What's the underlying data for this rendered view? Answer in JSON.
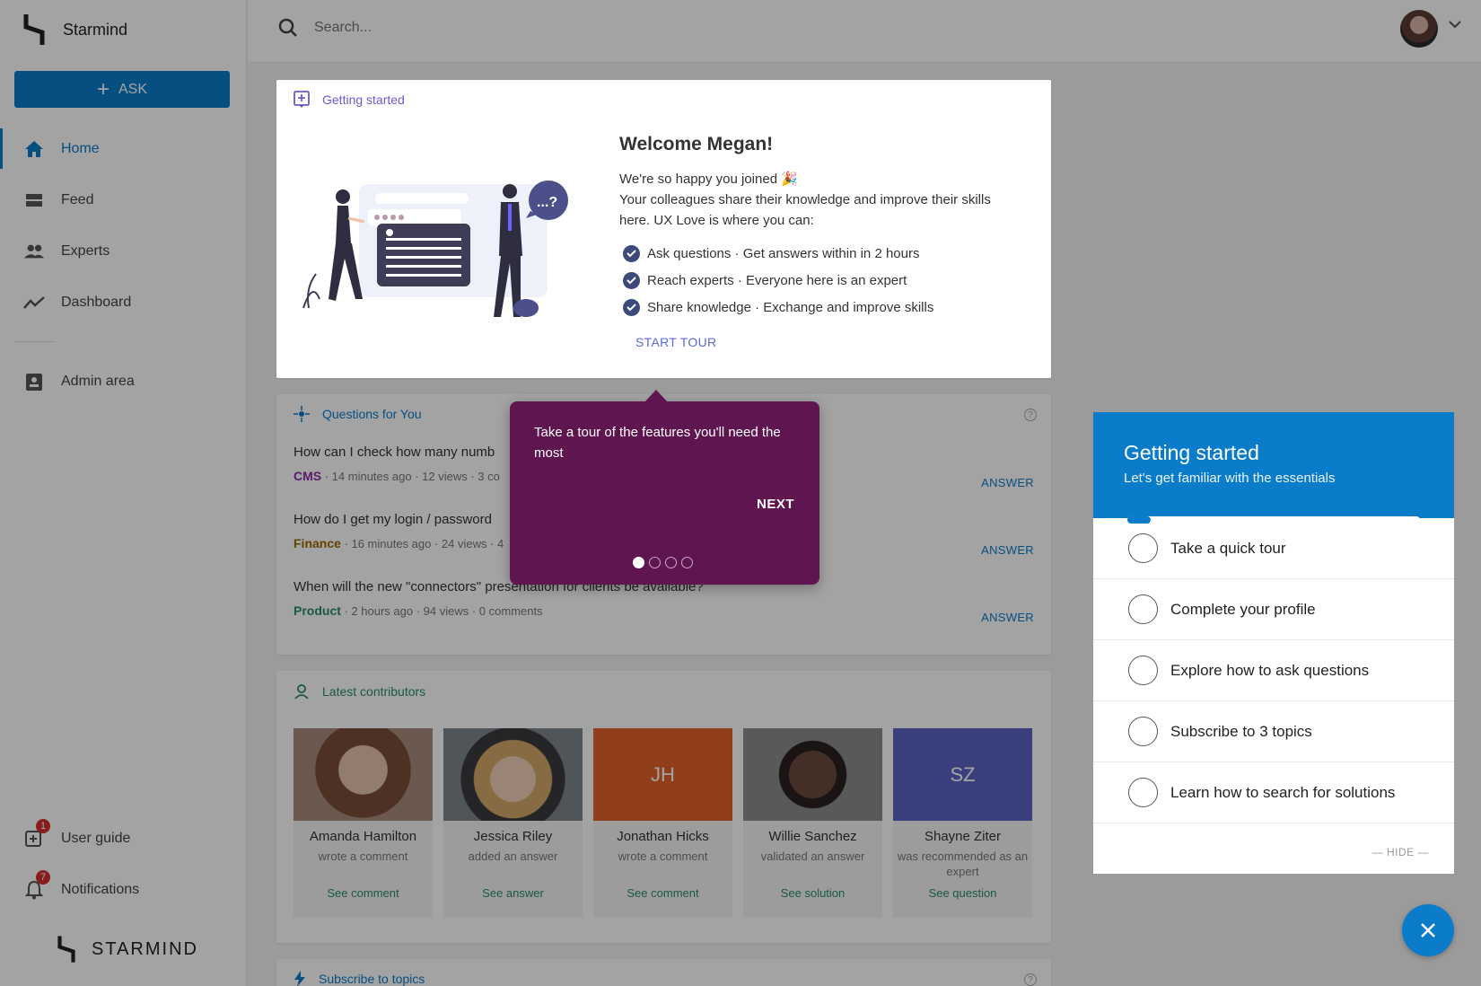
{
  "app": {
    "brand_name": "Starmind",
    "footer_brand": "STARMIND"
  },
  "sidebar": {
    "ask_label": "ASK",
    "items": [
      {
        "label": "Home",
        "icon": "home-icon",
        "active": true
      },
      {
        "label": "Feed",
        "icon": "feed-icon"
      },
      {
        "label": "Experts",
        "icon": "experts-icon"
      },
      {
        "label": "Dashboard",
        "icon": "dashboard-icon"
      }
    ],
    "admin_label": "Admin area",
    "user_guide_label": "User guide",
    "user_guide_badge": "1",
    "notifications_label": "Notifications",
    "notifications_badge": "7"
  },
  "search": {
    "placeholder": "Search..."
  },
  "welcome_card": {
    "header": "Getting started",
    "title": "Welcome Megan!",
    "text_line1": "We're so happy you joined 🎉",
    "text_line2": "Your colleagues share their knowledge and improve their skills here. UX Love is where you can:",
    "checks": [
      "Ask questions · Get answers within in 2 hours",
      "Reach experts · Everyone here is an expert",
      "Share knowledge · Exchange and improve skills"
    ],
    "start_tour": "START TOUR",
    "bubble_text": "...?"
  },
  "questions": {
    "header": "Questions for You",
    "help": "?",
    "answer_label": "ANSWER",
    "items": [
      {
        "title": "How can I check how many numb",
        "category": "CMS",
        "category_color": "#8a2da8",
        "meta": " · 14 minutes ago · 12 views · 3 co"
      },
      {
        "title": "How do I get my login / password",
        "category": "Finance",
        "category_color": "#9a6a00",
        "meta": " · 16 minutes ago · 24 views · 4"
      },
      {
        "title": "When will the new \"connectors\" presentation for clients be available?",
        "category": "Product",
        "category_color": "#2a8a6b",
        "meta": " · 2 hours ago · 94 views · 0 comments"
      }
    ]
  },
  "contributors": {
    "header": "Latest contributors",
    "people": [
      {
        "name": "Amanda Hamilton",
        "action": "wrote a comment",
        "link": "See comment",
        "initials": "",
        "photo_color": "#8a6a5a"
      },
      {
        "name": "Jessica Riley",
        "action": "added an answer",
        "link": "See answer",
        "initials": "",
        "photo_color": "#b09080"
      },
      {
        "name": "Jonathan Hicks",
        "action": "wrote a comment",
        "link": "See comment",
        "initials": "JH",
        "photo_color": "#e2622d"
      },
      {
        "name": "Willie Sanchez",
        "action": "validated an answer",
        "link": "See solution",
        "initials": "",
        "photo_color": "#5a4a44"
      },
      {
        "name": "Shayne Ziter",
        "action": "was recommended as an expert",
        "link": "See question",
        "initials": "SZ",
        "photo_color": "#5b63c4"
      }
    ]
  },
  "subscribe": {
    "header": "Subscribe to topics"
  },
  "tour_tooltip": {
    "text": "Take a tour of the features you'll need the most",
    "next_label": "NEXT",
    "step": 1,
    "total_steps": 4
  },
  "getting_started_panel": {
    "title": "Getting started",
    "subtitle": "Let's get familiar with the essentials",
    "progress": 0.08,
    "items": [
      "Take a quick tour",
      "Complete your profile",
      "Explore how to ask questions",
      "Subscribe to 3 topics",
      "Learn how to search for solutions"
    ],
    "hide_label": "— HIDE —"
  },
  "colors": {
    "primary": "#0b7cc9",
    "tooltip": "#5e1550"
  }
}
